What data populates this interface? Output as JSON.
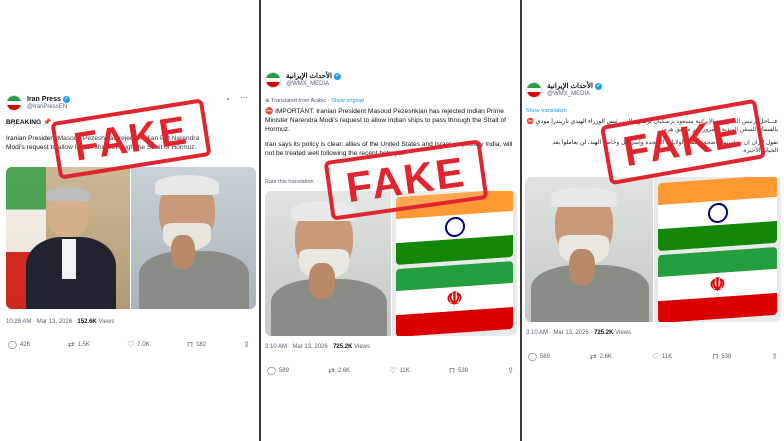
{
  "tweets": [
    {
      "display_name": "Iran Press",
      "handle": "@IranPressEN",
      "text_lines": [
        "Iranian President Masoud Pezeshkian rejects Indian PM Narendra",
        "Modi's request to allow Indian ships through the Strait of Hormuz."
      ],
      "breaking": "BREAKING",
      "breaking_emoji": "📌",
      "meta": {
        "time": "10:28 AM",
        "date": "Mar 13, 2026",
        "views": "152.6K",
        "views_label": "Views"
      },
      "actions": {
        "reply": "42K",
        "retweet": "1.5K",
        "like": "7.0K",
        "bookmark": "182"
      },
      "stamp": "FAKE"
    },
    {
      "display_name": "الأحداث الإيرانية",
      "handle": "@WMX_MEDIA",
      "translated_prefix": "Translated from Arabic",
      "translated_link": "Show original",
      "text_p1": "IMPORTANT: Iranian President Masoud Pezeshkian has rejected Indian Prime Minister Narendra Modi's request to allow Indian ships to pass through the Strait of Hormuz.",
      "text_p2": "Iran says its policy is clear: allies of the United States and Israel, especially India, will not be treated well following the recent betrayal.",
      "rate_translation": "Rate this translation",
      "meta": {
        "time": "3:10 AM",
        "date": "Mar 13, 2026",
        "views": "725.2K",
        "views_label": "Views"
      },
      "actions": {
        "reply": "589",
        "retweet": "2.6K",
        "like": "11K",
        "bookmark": "538"
      },
      "stamp": "FAKE"
    },
    {
      "display_name": "الأحداث الإيرانية",
      "handle": "@WMX_MEDIA",
      "show_translation": "Show translation",
      "text_lines": [
        "عـــاجل: رئيس الجمهورية الإيرانية مسعود بزشكيان يرفض طلب رئيس الوزراء الهندي ناريندرا مودي",
        "بالسماح للسفن الهندية بالمرور عبر مضيق هرمز.",
        "تقول إيران إن سياستها واضحة: حلفاء الولايات المتحدة وإسرائيل وخاصة الهند، لن يعاملوا بعد",
        "الخيانة الأخيرة."
      ],
      "meta": {
        "time": "3:10 AM",
        "date": "Mar 13, 2026",
        "views": "725.2K",
        "views_label": "Views"
      },
      "actions": {
        "reply": "589",
        "retweet": "2.6K",
        "like": "11K",
        "bookmark": "538"
      },
      "stamp": "FAKE"
    }
  ],
  "colors": {
    "stamp": "#e0252f",
    "link": "#1d9bf0",
    "verified": "#1d9bf0",
    "saffron": "#ff9933",
    "india_green": "#138808",
    "iran_green": "#239f40",
    "iran_red": "#da0000",
    "chakra": "#000080"
  }
}
